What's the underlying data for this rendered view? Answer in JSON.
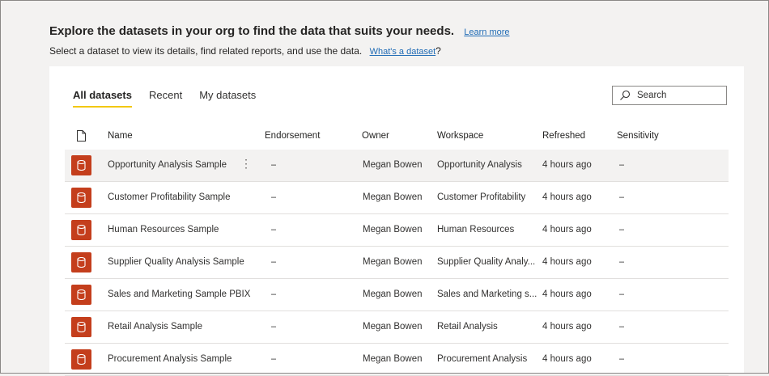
{
  "header": {
    "title": "Explore the datasets in your org to find the data that suits your needs.",
    "learn_more": "Learn more",
    "subtitle": "Select a dataset to view its details, find related reports, and use the data.",
    "whats_a_dataset": "What's a dataset",
    "whats_suffix": "?"
  },
  "tabs": [
    {
      "label": "All datasets",
      "active": true
    },
    {
      "label": "Recent",
      "active": false
    },
    {
      "label": "My datasets",
      "active": false
    }
  ],
  "search": {
    "placeholder": "Search"
  },
  "columns": {
    "type_icon": "file-icon",
    "name": "Name",
    "endorsement": "Endorsement",
    "owner": "Owner",
    "workspace": "Workspace",
    "refreshed": "Refreshed",
    "sensitivity": "Sensitivity"
  },
  "colors": {
    "dataset_icon": "#c43e1c",
    "tab_underline": "#f2c811",
    "link": "#1f6bb5"
  },
  "rows": [
    {
      "name": "Opportunity Analysis Sample",
      "endorsement": "–",
      "owner": "Megan Bowen",
      "workspace": "Opportunity Analysis",
      "refreshed": "4 hours ago",
      "sensitivity": "–",
      "more": "⋮"
    },
    {
      "name": "Customer Profitability Sample",
      "endorsement": "–",
      "owner": "Megan Bowen",
      "workspace": "Customer Profitability",
      "refreshed": "4 hours ago",
      "sensitivity": "–"
    },
    {
      "name": "Human Resources Sample",
      "endorsement": "–",
      "owner": "Megan Bowen",
      "workspace": "Human Resources",
      "refreshed": "4 hours ago",
      "sensitivity": "–"
    },
    {
      "name": "Supplier Quality Analysis Sample",
      "endorsement": "–",
      "owner": "Megan Bowen",
      "workspace": "Supplier Quality Analy...",
      "refreshed": "4 hours ago",
      "sensitivity": "–"
    },
    {
      "name": "Sales and Marketing Sample PBIX",
      "endorsement": "–",
      "owner": "Megan Bowen",
      "workspace": "Sales and Marketing s...",
      "refreshed": "4 hours ago",
      "sensitivity": "–"
    },
    {
      "name": "Retail Analysis Sample",
      "endorsement": "–",
      "owner": "Megan Bowen",
      "workspace": "Retail Analysis",
      "refreshed": "4 hours ago",
      "sensitivity": "–"
    },
    {
      "name": "Procurement Analysis Sample",
      "endorsement": "–",
      "owner": "Megan Bowen",
      "workspace": "Procurement Analysis",
      "refreshed": "4 hours ago",
      "sensitivity": "–"
    }
  ]
}
